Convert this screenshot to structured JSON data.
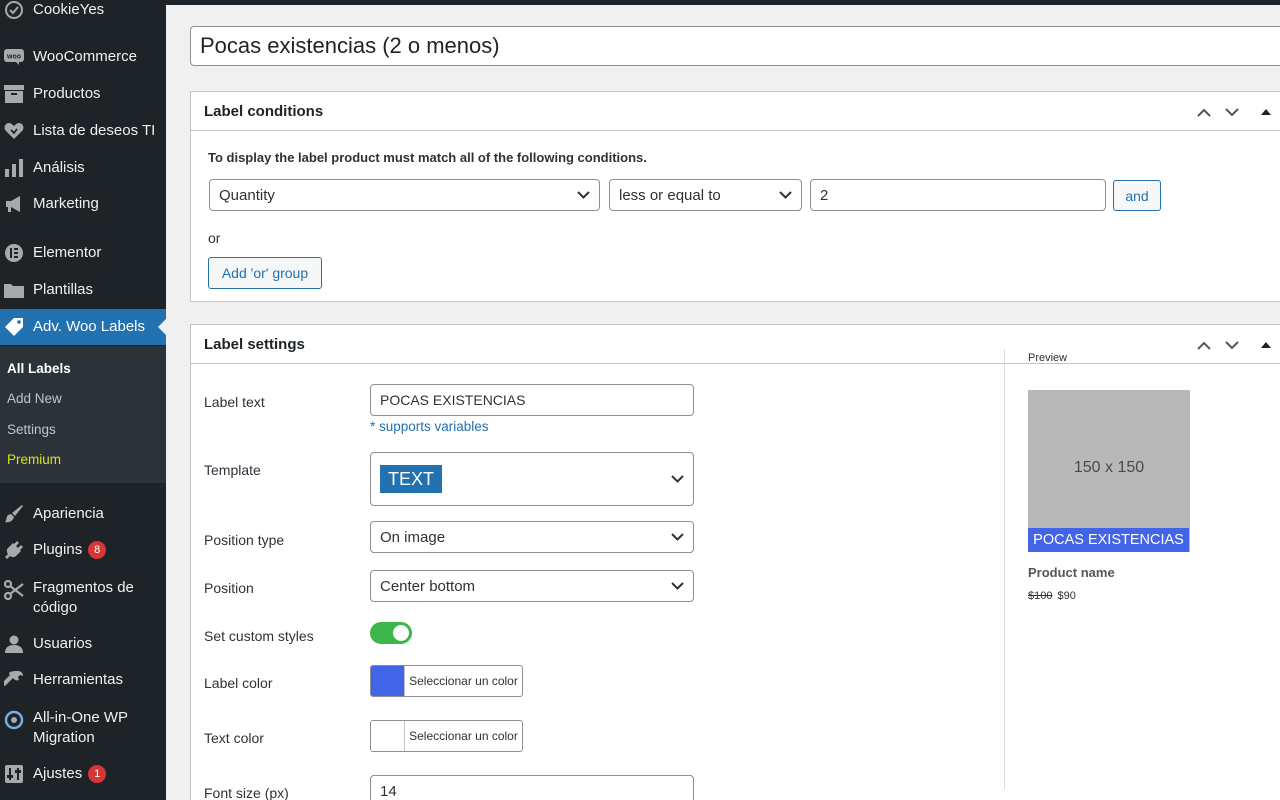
{
  "sidebar": {
    "items": [
      {
        "label": "CookieYes",
        "icon": "cookieyes-icon"
      },
      {
        "label": "WooCommerce",
        "icon": "woocommerce-icon"
      },
      {
        "label": "Productos",
        "icon": "products-archive-icon"
      },
      {
        "label": "Lista de deseos TI",
        "icon": "heart-icon"
      },
      {
        "label": "Análisis",
        "icon": "bar-chart-icon"
      },
      {
        "label": "Marketing",
        "icon": "megaphone-icon"
      },
      {
        "label": "Elementor",
        "icon": "elementor-icon"
      },
      {
        "label": "Plantillas",
        "icon": "folder-icon"
      },
      {
        "label": "Adv. Woo Labels",
        "icon": "tag-icon"
      },
      {
        "label": "Apariencia",
        "icon": "paintbrush-icon"
      },
      {
        "label": "Plugins",
        "icon": "plug-icon",
        "badge": "8"
      },
      {
        "label": "Fragmentos de código",
        "icon": "scissors-icon"
      },
      {
        "label": "Usuarios",
        "icon": "user-icon"
      },
      {
        "label": "Herramientas",
        "icon": "wrench-icon"
      },
      {
        "label": "All-in-One WP Migration",
        "icon": "migration-icon"
      },
      {
        "label": "Ajustes",
        "icon": "settings-icon",
        "badge": "1"
      }
    ],
    "submenu": [
      "All Labels",
      "Add New",
      "Settings",
      "Premium"
    ]
  },
  "title": "Pocas existencias (2 o menos)",
  "conditions": {
    "title": "Label conditions",
    "intro": "To display the label product must match all of the following conditions.",
    "field": "Quantity",
    "operator": "less or equal to",
    "value": "2",
    "and_label": "and",
    "or_label": "or",
    "add_or_label": "Add 'or' group"
  },
  "settings": {
    "title": "Label settings",
    "label_text_label": "Label text",
    "label_text_value": "POCAS EXISTENCIAS",
    "supports_variables": "* supports variables",
    "template_label": "Template",
    "template_value": "TEXT",
    "position_type_label": "Position type",
    "position_type_value": "On image",
    "position_label": "Position",
    "position_value": "Center bottom",
    "custom_styles_label": "Set custom styles",
    "custom_styles_on": true,
    "label_color_label": "Label color",
    "label_color": "#4264e7",
    "text_color_label": "Text color",
    "text_color": "#ffffff",
    "color_button": "Seleccionar un color",
    "font_size_label": "Font size (px)",
    "font_size_value": "14"
  },
  "preview": {
    "title": "Preview",
    "placeholder": "150 x 150",
    "label": "POCAS EXISTENCIAS",
    "product_name": "Product name",
    "old_price": "$100",
    "price": "$90"
  },
  "colors": {
    "sidebar_bg": "#1d2327",
    "active": "#2271b1",
    "toggle_on": "#3cb54a",
    "premium": "#d5e321"
  }
}
